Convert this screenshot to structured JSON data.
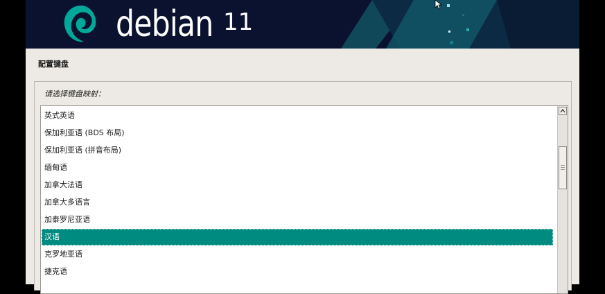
{
  "banner": {
    "logo_text": "debian",
    "version": "11"
  },
  "page": {
    "title": "配置键盘",
    "prompt": "请选择键盘映射："
  },
  "keymap_list": {
    "items": [
      "英式英语",
      "保加利亚语 (BDS 布局)",
      "保加利亚语 (拼音布局)",
      "缅甸语",
      "加拿大法语",
      "加拿大多语言",
      "加泰罗尼亚语",
      "汉语",
      "克罗地亚语",
      "捷克语"
    ],
    "selected": "汉语"
  },
  "colors": {
    "banner_bg": "#0b1230",
    "accent_teal": "#008b80",
    "panel_bg": "#edeae5"
  }
}
